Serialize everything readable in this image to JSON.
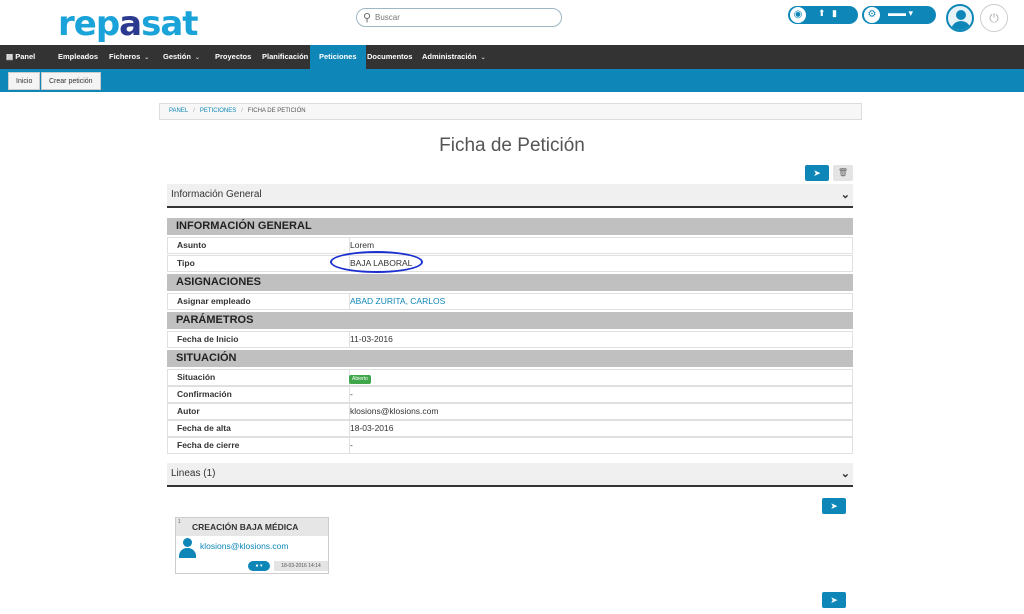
{
  "app": {
    "logo_prefix": "rep",
    "logo_highlight": "a",
    "logo_suffix": "sat"
  },
  "search": {
    "placeholder": "Buscar"
  },
  "header_icons": {
    "notifications": "bell-icon",
    "settings": "gear-icon",
    "language_label": "▬▬ ▾"
  },
  "nav": {
    "panel": "Panel",
    "items": [
      {
        "label": "Empleados"
      },
      {
        "label": "Ficheros",
        "dropdown": true
      },
      {
        "label": "Gestión",
        "dropdown": true
      },
      {
        "label": "Proyectos"
      },
      {
        "label": "Planificación"
      },
      {
        "label": "Peticiones",
        "active": true
      },
      {
        "label": "Documentos"
      },
      {
        "label": "Administración",
        "dropdown": true
      }
    ]
  },
  "subnav": {
    "inicio": "Inicio",
    "crear": "Crear petición"
  },
  "breadcrumb": {
    "panel": "PANEL",
    "peticiones": "PETICIONES",
    "current": "FICHA DE PETICIÓN"
  },
  "page_title": "Ficha de Petición",
  "info_section": {
    "title": "Información General"
  },
  "groups": {
    "general": "INFORMACIÓN GENERAL",
    "asignaciones": "ASIGNACIONES",
    "parametros": "PARÁMETROS",
    "situacion": "SITUACIÓN"
  },
  "fields": {
    "asunto": {
      "label": "Asunto",
      "value": "Lorem"
    },
    "tipo": {
      "label": "Tipo",
      "value": "BAJA LABORAL"
    },
    "empleado": {
      "label": "Asignar empleado",
      "value": "ABAD ZURITA, CARLOS"
    },
    "fecha_inicio": {
      "label": "Fecha de Inicio",
      "value": "11-03-2016"
    },
    "situacion": {
      "label": "Situación",
      "value": "Abierto"
    },
    "confirmacion": {
      "label": "Confirmación",
      "value": "-"
    },
    "autor": {
      "label": "Autor",
      "value": "klosions@klosions.com"
    },
    "fecha_alta": {
      "label": "Fecha de alta",
      "value": "18-03-2016"
    },
    "fecha_cierre": {
      "label": "Fecha de cierre",
      "value": "-"
    }
  },
  "lineas_section": {
    "title": "Lineas (1)"
  },
  "line_card": {
    "number": "1",
    "title": "CREACIÓN BAJA MÉDICA",
    "author": "klosions@klosions.com",
    "date": "18-03-2016 14:14",
    "toggle": "● ▾"
  },
  "colors": {
    "primary": "#0e87b8",
    "navbar": "#333333",
    "status_open": "#3fa64a",
    "annotation": "#1a2fd1"
  }
}
